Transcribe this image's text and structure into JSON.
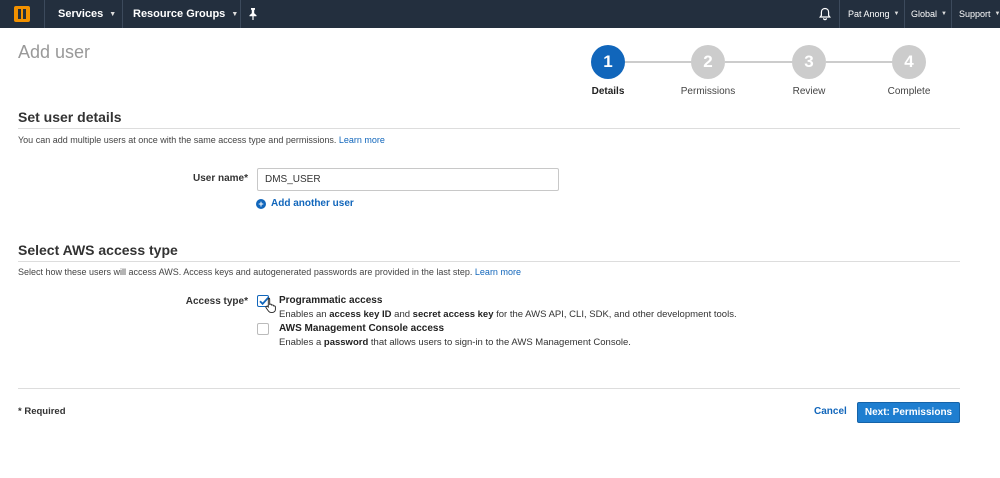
{
  "nav": {
    "services_label": "Services",
    "resource_groups_label": "Resource Groups",
    "user_label": "Pat Anong",
    "region_label": "Global",
    "support_label": "Support"
  },
  "page": {
    "title": "Add user"
  },
  "stepper": {
    "steps": [
      {
        "number": "1",
        "label": "Details",
        "active": true
      },
      {
        "number": "2",
        "label": "Permissions",
        "active": false
      },
      {
        "number": "3",
        "label": "Review",
        "active": false
      },
      {
        "number": "4",
        "label": "Complete",
        "active": false
      }
    ]
  },
  "user_details": {
    "title": "Set user details",
    "description": "You can add multiple users at once with the same access type and permissions.",
    "learn_more": "Learn more",
    "user_name_label": "User name*",
    "user_name_value": "DMS_USER",
    "add_another_user": "Add another user"
  },
  "access_type": {
    "title": "Select AWS access type",
    "description": "Select how these users will access AWS. Access keys and autogenerated passwords are provided in the last step.",
    "learn_more": "Learn more",
    "label": "Access type*",
    "options": [
      {
        "title": "Programmatic access",
        "checked": true,
        "desc_parts": [
          "Enables an ",
          "access key ID",
          " and ",
          "secret access key",
          " for the AWS API, CLI, SDK, and other development tools."
        ]
      },
      {
        "title": "AWS Management Console access",
        "checked": false,
        "desc_parts": [
          "Enables a ",
          "password",
          " that allows users to sign-in to the AWS Management Console."
        ]
      }
    ]
  },
  "footer": {
    "required_note": "* Required",
    "cancel_label": "Cancel",
    "next_label": "Next: Permissions"
  },
  "colors": {
    "nav_bg": "#232f3e",
    "accent": "#1166bb",
    "primary_button": "#1e7ed0",
    "step_inactive": "#cccccc",
    "logo": "#f29100"
  }
}
